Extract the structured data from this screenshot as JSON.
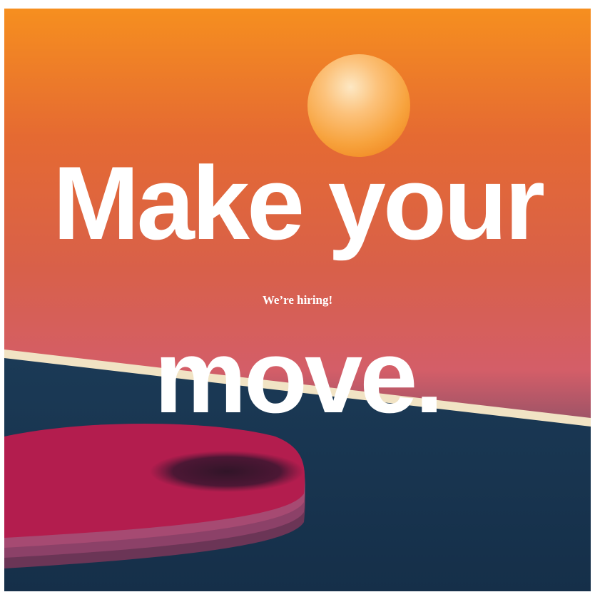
{
  "headline": {
    "line1": "Make your",
    "line2": "move."
  },
  "tagline": "We’re hiring!",
  "colors": {
    "sky_top": "#f68f1f",
    "sky_mid": "#d8604a",
    "sky_low": "#d45e68",
    "table": "#183652",
    "table_edge_line": "#f1e3c4",
    "paddle_face": "#b31d4e",
    "ball": "#f8a542",
    "text": "#ffffff"
  }
}
